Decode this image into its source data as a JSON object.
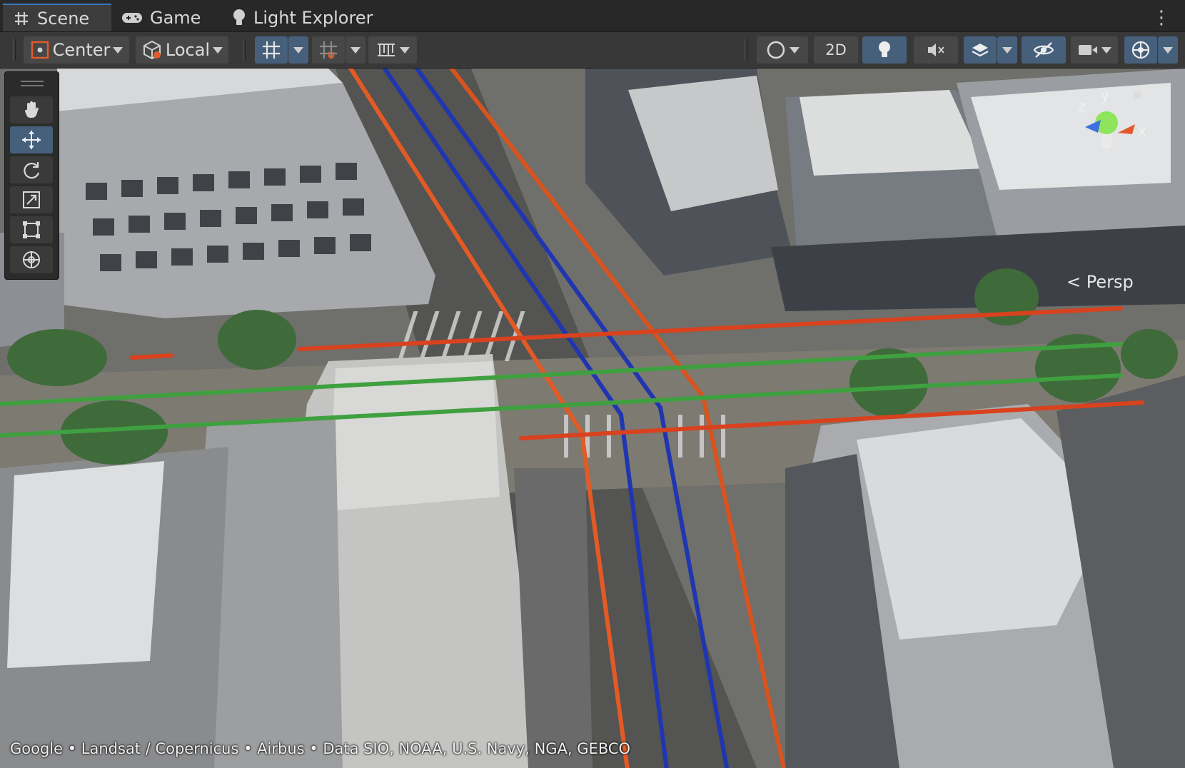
{
  "tabs": [
    {
      "label": "Scene",
      "icon": "grid-hash-icon",
      "active": true
    },
    {
      "label": "Game",
      "icon": "gamepad-icon",
      "active": false
    },
    {
      "label": "Light Explorer",
      "icon": "lightbulb-icon",
      "active": false
    }
  ],
  "toolbar": {
    "pivot_mode": "Center",
    "pivot_rotation": "Local",
    "view_2d": "2D"
  },
  "tools": [
    "hand-tool-icon",
    "move-tool-icon",
    "rotate-tool-icon",
    "scale-tool-icon",
    "rect-tool-icon",
    "transform-tool-icon"
  ],
  "active_tool": "move-tool-icon",
  "gizmo": {
    "x": "x",
    "y": "y",
    "z": "z",
    "projection": "Persp"
  },
  "attribution": "Google • Landsat / Copernicus • Airbus • Data SIO, NOAA, U.S. Navy, NGA, GEBCO",
  "colors": {
    "accent_blue": "#46607c",
    "axis_x": "#e35a2a",
    "axis_y": "#8ee45a",
    "axis_z": "#3c6fe0",
    "line_orange": "#e35a24",
    "line_blue": "#2036b0",
    "line_green": "#3fa040"
  }
}
